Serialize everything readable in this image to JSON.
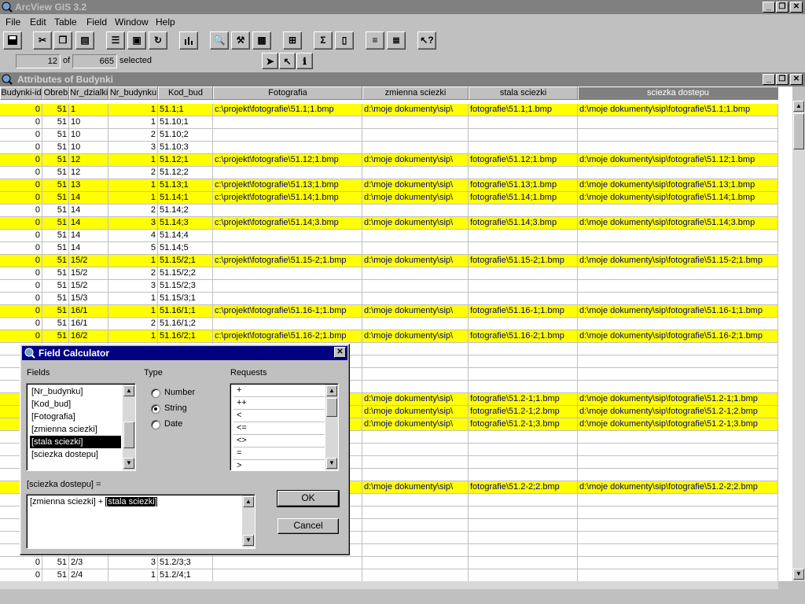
{
  "app": {
    "title": "ArcView GIS 3.2"
  },
  "menu": [
    "File",
    "Edit",
    "Table",
    "Field",
    "Window",
    "Help"
  ],
  "status": {
    "selected_count": "12",
    "of_label": "of",
    "total": "665",
    "selected_label": "selected"
  },
  "table": {
    "title": "Attributes of Budynki",
    "columns": [
      "Budynki-id",
      "Obreb",
      "Nr_dzialki",
      "Nr_budynku",
      "Kod_bud",
      "Fotografia",
      "zmienna sciezki",
      "stala sciezki",
      "sciezka dostepu"
    ],
    "rows": [
      {
        "hl": true,
        "c": [
          "0",
          "51",
          "1",
          "1",
          "51.1;1",
          "c:\\projekt\\fotografie\\51.1;1.bmp",
          "d:\\moje dokumenty\\sip\\",
          "fotografie\\51.1;1.bmp",
          "d:\\moje dokumenty\\sip\\fotografie\\51.1;1.bmp"
        ]
      },
      {
        "hl": false,
        "c": [
          "0",
          "51",
          "10",
          "1",
          "51.10;1",
          "",
          "",
          "",
          ""
        ]
      },
      {
        "hl": false,
        "c": [
          "0",
          "51",
          "10",
          "2",
          "51.10;2",
          "",
          "",
          "",
          ""
        ]
      },
      {
        "hl": false,
        "c": [
          "0",
          "51",
          "10",
          "3",
          "51.10;3",
          "",
          "",
          "",
          ""
        ]
      },
      {
        "hl": true,
        "c": [
          "0",
          "51",
          "12",
          "1",
          "51.12;1",
          "c:\\projekt\\fotografie\\51.12;1.bmp",
          "d:\\moje dokumenty\\sip\\",
          "fotografie\\51.12;1.bmp",
          "d:\\moje dokumenty\\sip\\fotografie\\51.12;1.bmp"
        ]
      },
      {
        "hl": false,
        "c": [
          "0",
          "51",
          "12",
          "2",
          "51.12;2",
          "",
          "",
          "",
          ""
        ]
      },
      {
        "hl": true,
        "c": [
          "0",
          "51",
          "13",
          "1",
          "51.13;1",
          "c:\\projekt\\fotografie\\51.13;1.bmp",
          "d:\\moje dokumenty\\sip\\",
          "fotografie\\51.13;1.bmp",
          "d:\\moje dokumenty\\sip\\fotografie\\51.13;1.bmp"
        ]
      },
      {
        "hl": true,
        "c": [
          "0",
          "51",
          "14",
          "1",
          "51.14;1",
          "c:\\projekt\\fotografie\\51.14;1.bmp",
          "d:\\moje dokumenty\\sip\\",
          "fotografie\\51.14;1.bmp",
          "d:\\moje dokumenty\\sip\\fotografie\\51.14;1.bmp"
        ]
      },
      {
        "hl": false,
        "c": [
          "0",
          "51",
          "14",
          "2",
          "51.14;2",
          "",
          "",
          "",
          ""
        ]
      },
      {
        "hl": true,
        "c": [
          "0",
          "51",
          "14",
          "3",
          "51.14;3",
          "c:\\projekt\\fotografie\\51.14;3.bmp",
          "d:\\moje dokumenty\\sip\\",
          "fotografie\\51.14;3.bmp",
          "d:\\moje dokumenty\\sip\\fotografie\\51.14;3.bmp"
        ]
      },
      {
        "hl": false,
        "c": [
          "0",
          "51",
          "14",
          "4",
          "51.14;4",
          "",
          "",
          "",
          ""
        ]
      },
      {
        "hl": false,
        "c": [
          "0",
          "51",
          "14",
          "5",
          "51.14;5",
          "",
          "",
          "",
          ""
        ]
      },
      {
        "hl": true,
        "c": [
          "0",
          "51",
          "15/2",
          "1",
          "51.15/2;1",
          "c:\\projekt\\fotografie\\51.15-2;1.bmp",
          "d:\\moje dokumenty\\sip\\",
          "fotografie\\51.15-2;1.bmp",
          "d:\\moje dokumenty\\sip\\fotografie\\51.15-2;1.bmp"
        ]
      },
      {
        "hl": false,
        "c": [
          "0",
          "51",
          "15/2",
          "2",
          "51.15/2;2",
          "",
          "",
          "",
          ""
        ]
      },
      {
        "hl": false,
        "c": [
          "0",
          "51",
          "15/2",
          "3",
          "51.15/2;3",
          "",
          "",
          "",
          ""
        ]
      },
      {
        "hl": false,
        "c": [
          "0",
          "51",
          "15/3",
          "1",
          "51.15/3;1",
          "",
          "",
          "",
          ""
        ]
      },
      {
        "hl": true,
        "c": [
          "0",
          "51",
          "16/1",
          "1",
          "51.16/1;1",
          "c:\\projekt\\fotografie\\51.16-1;1.bmp",
          "d:\\moje dokumenty\\sip\\",
          "fotografie\\51.16-1;1.bmp",
          "d:\\moje dokumenty\\sip\\fotografie\\51.16-1;1.bmp"
        ]
      },
      {
        "hl": false,
        "c": [
          "0",
          "51",
          "16/1",
          "2",
          "51.16/1;2",
          "",
          "",
          "",
          ""
        ]
      },
      {
        "hl": true,
        "c": [
          "0",
          "51",
          "16/2",
          "1",
          "51.16/2;1",
          "c:\\projekt\\fotografie\\51.16-2;1.bmp",
          "d:\\moje dokumenty\\sip\\",
          "fotografie\\51.16-2;1.bmp",
          "d:\\moje dokumenty\\sip\\fotografie\\51.16-2;1.bmp"
        ]
      },
      {
        "hl": false,
        "c": [
          "",
          "",
          "",
          "",
          "",
          "",
          "",
          "",
          ""
        ]
      },
      {
        "hl": false,
        "c": [
          "",
          "",
          "",
          "",
          "",
          "",
          "",
          "",
          ""
        ]
      },
      {
        "hl": false,
        "c": [
          "",
          "",
          "",
          "",
          "",
          "",
          "",
          "",
          ""
        ]
      },
      {
        "hl": false,
        "c": [
          "",
          "",
          "",
          "",
          "",
          "",
          "",
          "",
          ""
        ]
      },
      {
        "hl": true,
        "c": [
          "",
          "",
          "",
          "",
          "",
          "",
          "d:\\moje dokumenty\\sip\\",
          "fotografie\\51.2-1;1.bmp",
          "d:\\moje dokumenty\\sip\\fotografie\\51.2-1;1.bmp"
        ]
      },
      {
        "hl": true,
        "c": [
          "",
          "",
          "",
          "",
          "",
          "",
          "d:\\moje dokumenty\\sip\\",
          "fotografie\\51.2-1;2.bmp",
          "d:\\moje dokumenty\\sip\\fotografie\\51.2-1;2.bmp"
        ]
      },
      {
        "hl": true,
        "c": [
          "",
          "",
          "",
          "",
          "",
          "",
          "d:\\moje dokumenty\\sip\\",
          "fotografie\\51.2-1;3.bmp",
          "d:\\moje dokumenty\\sip\\fotografie\\51.2-1;3.bmp"
        ]
      },
      {
        "hl": false,
        "c": [
          "",
          "",
          "",
          "",
          "",
          "",
          "",
          "",
          ""
        ]
      },
      {
        "hl": false,
        "c": [
          "",
          "",
          "",
          "",
          "",
          "",
          "",
          "",
          ""
        ]
      },
      {
        "hl": false,
        "c": [
          "",
          "",
          "",
          "",
          "",
          "",
          "",
          "",
          ""
        ]
      },
      {
        "hl": false,
        "c": [
          "",
          "",
          "",
          "",
          "",
          "",
          "",
          "",
          ""
        ]
      },
      {
        "hl": true,
        "c": [
          "",
          "",
          "",
          "",
          "",
          "",
          "d:\\moje dokumenty\\sip\\",
          "fotografie\\51.2-2;2.bmp",
          "d:\\moje dokumenty\\sip\\fotografie\\51.2-2;2.bmp"
        ]
      },
      {
        "hl": false,
        "c": [
          "",
          "",
          "",
          "",
          "",
          "",
          "",
          "",
          ""
        ]
      },
      {
        "hl": false,
        "c": [
          "",
          "",
          "",
          "",
          "",
          "",
          "",
          "",
          ""
        ]
      },
      {
        "hl": false,
        "c": [
          "",
          "",
          "",
          "",
          "",
          "",
          "",
          "",
          ""
        ]
      },
      {
        "hl": false,
        "c": [
          "",
          "",
          "",
          "",
          "",
          "",
          "",
          "",
          ""
        ]
      },
      {
        "hl": false,
        "c": [
          "",
          "",
          "",
          "",
          "",
          "",
          "",
          "",
          ""
        ]
      },
      {
        "hl": false,
        "c": [
          "0",
          "51",
          "2/3",
          "3",
          "51.2/3;3",
          "",
          "",
          "",
          ""
        ]
      },
      {
        "hl": false,
        "c": [
          "0",
          "51",
          "2/4",
          "1",
          "51.2/4;1",
          "",
          "",
          "",
          ""
        ]
      }
    ]
  },
  "dialog": {
    "title": "Field Calculator",
    "fields_label": "Fields",
    "fields": [
      "[Nr_budynku]",
      "[Kod_bud]",
      "[Fotografia]",
      "[zmienna sciezki]",
      "[stala sciezki]",
      "[sciezka dostepu]"
    ],
    "selected_field_index": 4,
    "type_label": "Type",
    "types": [
      "Number",
      "String",
      "Date"
    ],
    "selected_type": "String",
    "requests_label": "Requests",
    "requests": [
      "+",
      "++",
      "<",
      "<=",
      "<>",
      "=",
      ">"
    ],
    "expr_label": "[sciezka dostepu] =",
    "expr_plain": "[zmienna sciezki] + ",
    "expr_selected": "[stala sciezki]",
    "ok_label": "OK",
    "cancel_label": "Cancel"
  }
}
